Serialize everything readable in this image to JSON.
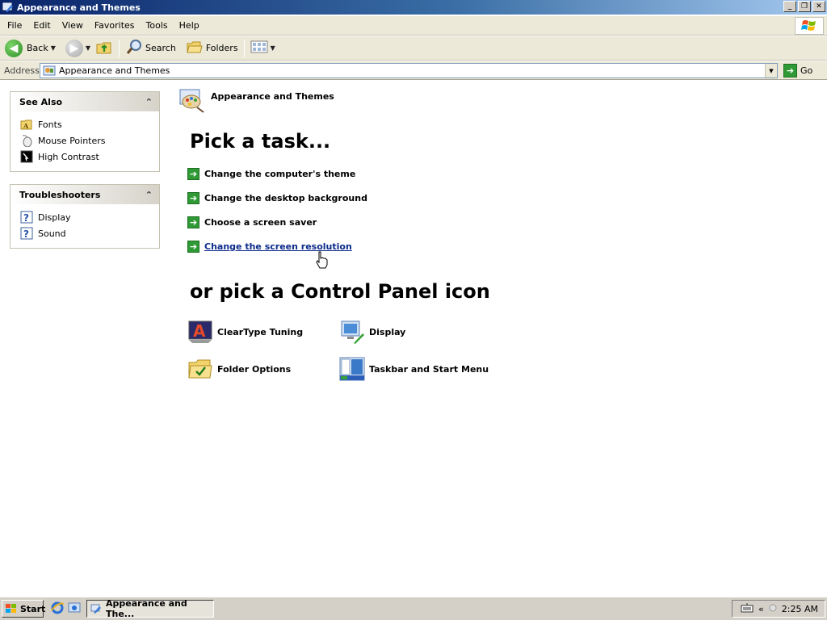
{
  "window": {
    "title": "Appearance and Themes",
    "controls": {
      "minimize": "_",
      "restore": "❐",
      "close": "✕"
    }
  },
  "menubar": {
    "items": [
      "File",
      "Edit",
      "View",
      "Favorites",
      "Tools",
      "Help"
    ]
  },
  "toolbar": {
    "back_label": "Back",
    "search_label": "Search",
    "folders_label": "Folders"
  },
  "address": {
    "label": "Address",
    "value": "Appearance and Themes",
    "go_label": "Go"
  },
  "see_also": {
    "title": "See Also",
    "links": [
      "Fonts",
      "Mouse Pointers",
      "High Contrast"
    ]
  },
  "troubleshooters": {
    "title": "Troubleshooters",
    "links": [
      "Display",
      "Sound"
    ]
  },
  "main": {
    "category_title": "Appearance and Themes",
    "pick_task_heading": "Pick a task...",
    "tasks": [
      "Change the computer's theme",
      "Change the desktop background",
      "Choose a screen saver",
      "Change the screen resolution"
    ],
    "hovered_task_index": 3,
    "pick_icon_heading": "or pick a Control Panel icon",
    "icons": [
      "ClearType Tuning",
      "Display",
      "Folder Options",
      "Taskbar and Start Menu"
    ]
  },
  "taskbar": {
    "start_label": "Start",
    "window_button_label": "Appearance and The...",
    "tray_chevron": "«",
    "clock": "2:25 AM"
  },
  "colors": {
    "title_gradient_start": "#0a246a",
    "task_arrow_green": "#2f9a35",
    "link_hover_blue": "#0b2a8a"
  },
  "icon_names": [
    "folder-up-icon",
    "search-icon",
    "folders-icon",
    "views-icon",
    "windows-logo-icon"
  ]
}
